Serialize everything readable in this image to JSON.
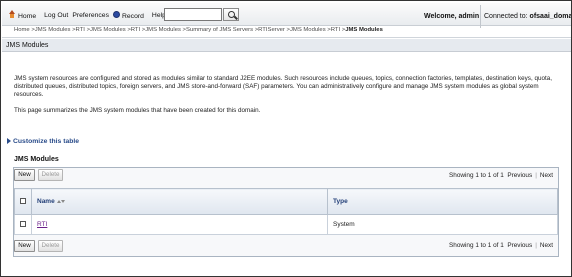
{
  "header": {
    "nav_items": [
      {
        "label": "Home",
        "icon": "home-icon"
      },
      {
        "label": "Log Out"
      },
      {
        "label": "Preferences"
      },
      {
        "label": "Record",
        "icon": "record-icon"
      },
      {
        "label": "Help"
      }
    ],
    "search": {
      "value": "",
      "placeholder": ""
    },
    "welcome": "Welcome, admin",
    "connected_label": "Connected to:",
    "domain": "ofsaai_domain"
  },
  "breadcrumb": {
    "links": "Home >JMS Modules >RTI >JMS Modules >RTI >JMS Modules >Summary of JMS Servers >RTIServer >JMS Modules >RTI >",
    "current": "JMS Modules"
  },
  "page": {
    "title": "JMS Modules",
    "description": "JMS system resources are configured and stored as modules similar to standard J2EE modules. Such resources include queues, topics, connection factories, templates, destination keys, quota, distributed queues, distributed topics, foreign servers, and JMS store-and-forward (SAF) parameters. You can administratively configure and manage JMS system modules as global system resources.",
    "summary": "This page summarizes the JMS system modules that have been created for this domain.",
    "customize": "Customize this table"
  },
  "table": {
    "title": "JMS Modules",
    "new_label": "New",
    "delete_label": "Delete",
    "paging": {
      "showing": "Showing 1 to 1 of 1",
      "previous": "Previous",
      "next": "Next"
    },
    "columns": [
      "Name",
      "Type"
    ],
    "rows": [
      {
        "name": "RTI",
        "type": "System"
      }
    ]
  }
}
